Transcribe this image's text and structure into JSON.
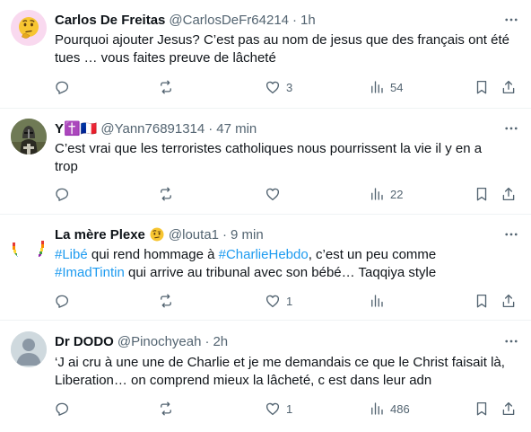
{
  "tweets": [
    {
      "name": "Carlos De Freitas",
      "handle": "@CarlosDeFr64214",
      "dot": "·",
      "time": "1h",
      "text_lines": [
        "Pourquoi ajouter Jesus? C’est pas au nom de jesus que des français ont été",
        "tues … vous faites preuve de lâcheté"
      ],
      "reply_count": "",
      "retweet_count": "",
      "like_count": "3",
      "view_count": "54"
    },
    {
      "name": "Y✝️🇫🇷",
      "handle": "@Yann76891314",
      "dot": "·",
      "time": "47 min",
      "text_lines": [
        "C’est vrai que les terroristes catholiques nous pourrissent la vie il y en a",
        "trop"
      ],
      "reply_count": "",
      "retweet_count": "",
      "like_count": "",
      "view_count": "22"
    },
    {
      "name": "La mère Plexe",
      "handle": "@louta1",
      "dot": "·",
      "time": "9 min",
      "line1": {
        "tag1": "#Libé",
        "mid": " qui rend hommage à ",
        "tag2": "#CharlieHebdo",
        "rest": ", c’est un peu comme"
      },
      "line2": {
        "tag1": "#ImadTintin",
        "rest": " qui arrive au tribunal avec son bébé… Taqqiya style"
      },
      "reply_count": "",
      "retweet_count": "",
      "like_count": "1",
      "view_count": ""
    },
    {
      "name": "Dr DODO",
      "handle": "@Pinochyeah",
      "dot": "·",
      "time": "2h",
      "text_lines": [
        "‘J ai cru à une une de Charlie et je me demandais ce que le Christ faisait là,",
        "Liberation… on comprend mieux la lâcheté, c est dans leur adn"
      ],
      "reply_count": "",
      "retweet_count": "",
      "like_count": "1",
      "view_count": "486"
    }
  ],
  "colors": {
    "text": "#0f1419",
    "secondary": "#536471",
    "link": "#1d9bf0",
    "divider": "#eff3f4"
  }
}
